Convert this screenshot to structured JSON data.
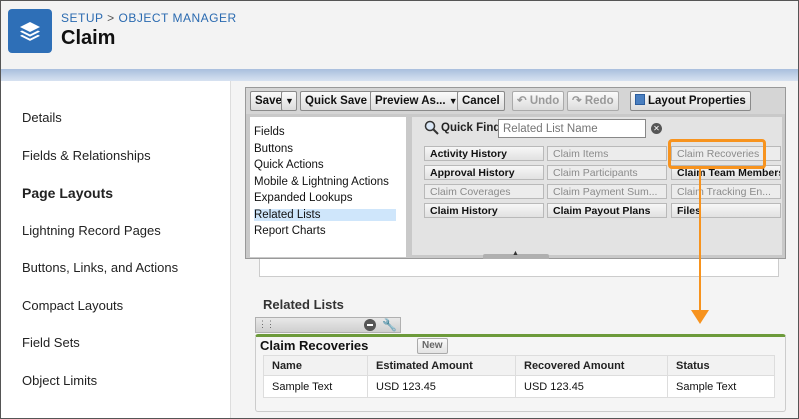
{
  "header": {
    "breadcrumb_setup": "SETUP",
    "breadcrumb_sep": ">",
    "breadcrumb_object_manager": "OBJECT MANAGER",
    "title": "Claim",
    "icon": "stack-layers-icon"
  },
  "leftnav": {
    "items": [
      {
        "label": "Details"
      },
      {
        "label": "Fields & Relationships"
      },
      {
        "label": "Page Layouts",
        "active": true
      },
      {
        "label": "Lightning Record Pages"
      },
      {
        "label": "Buttons, Links, and Actions"
      },
      {
        "label": "Compact Layouts"
      },
      {
        "label": "Field Sets"
      },
      {
        "label": "Object Limits"
      }
    ]
  },
  "toolbar": {
    "save": "Save",
    "quick_save": "Quick Save",
    "preview_as": "Preview As...",
    "cancel": "Cancel",
    "undo": "Undo",
    "redo": "Redo",
    "layout_properties": "Layout Properties"
  },
  "palette": {
    "categories": [
      {
        "label": "Fields"
      },
      {
        "label": "Buttons"
      },
      {
        "label": "Quick Actions"
      },
      {
        "label": "Mobile & Lightning Actions"
      },
      {
        "label": "Expanded Lookups"
      },
      {
        "label": "Related Lists",
        "selected": true
      },
      {
        "label": "Report Charts"
      }
    ],
    "quick_find_label": "Quick Find",
    "quick_find_placeholder": "Related List Name",
    "chips": [
      {
        "label": "Activity History",
        "enabled": true
      },
      {
        "label": "Claim Items",
        "enabled": false
      },
      {
        "label": "Claim Recoveries",
        "enabled": false
      },
      {
        "label": "Approval History",
        "enabled": true
      },
      {
        "label": "Claim Participants",
        "enabled": false
      },
      {
        "label": "Claim Team Members",
        "enabled": true
      },
      {
        "label": "Claim Coverages",
        "enabled": false
      },
      {
        "label": "Claim Payment Sum...",
        "enabled": false
      },
      {
        "label": "Claim Tracking En...",
        "enabled": false
      },
      {
        "label": "Claim History",
        "enabled": true
      },
      {
        "label": "Claim Payout Plans",
        "enabled": true
      },
      {
        "label": "Files",
        "enabled": true
      }
    ]
  },
  "related_lists": {
    "heading": "Related Lists",
    "list_title": "Claim Recoveries",
    "new_label": "New",
    "columns": [
      "Name",
      "Estimated Amount",
      "Recovered Amount",
      "Status"
    ],
    "rows": [
      [
        "Sample Text",
        "USD 123.45",
        "USD 123.45",
        "Sample Text"
      ]
    ]
  },
  "colors": {
    "highlight": "#f7931e",
    "header_icon": "#2e6fb7",
    "panel_accent": "#6c9a3a"
  }
}
